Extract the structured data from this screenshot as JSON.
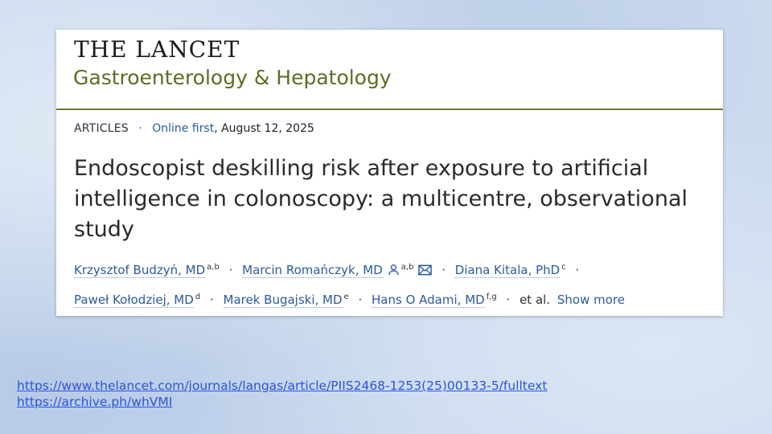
{
  "card": {
    "journal": "THE LANCET",
    "journal_sub": "Gastroenterology & Hepatology",
    "article_type": "ARTICLES",
    "separator": "·",
    "online_label": "Online first",
    "date": ", August 12, 2025",
    "title": "Endoscopist deskilling risk after exposure to artificial intelligence in colonoscopy: a multicentre, observational study",
    "authors": [
      {
        "name": "Krzysztof Budzyń, MD",
        "aff": "a,b"
      },
      {
        "name": "Marcin Romańczyk, MD",
        "aff": "a,b"
      },
      {
        "name": "Diana Kitala, PhD",
        "aff": "c"
      },
      {
        "name": "Paweł Kołodziej, MD",
        "aff": "d"
      },
      {
        "name": "Marek Bugajski, MD",
        "aff": "e"
      },
      {
        "name": "Hans O Adami, MD",
        "aff": "f,g"
      }
    ],
    "et_al": "et al.",
    "show_more": "Show more"
  },
  "links": [
    "https://www.thelancet.com/journals/langas/article/PIIS2468-1253(25)00133-5/fulltext",
    "https://archive.ph/whVMI"
  ],
  "colors": {
    "link": "#2a5b9c",
    "journal_sub": "#5b6e23",
    "rule": "#6b7a3a",
    "background": "#c9d9ee",
    "slide_link": "#2b55d6"
  }
}
